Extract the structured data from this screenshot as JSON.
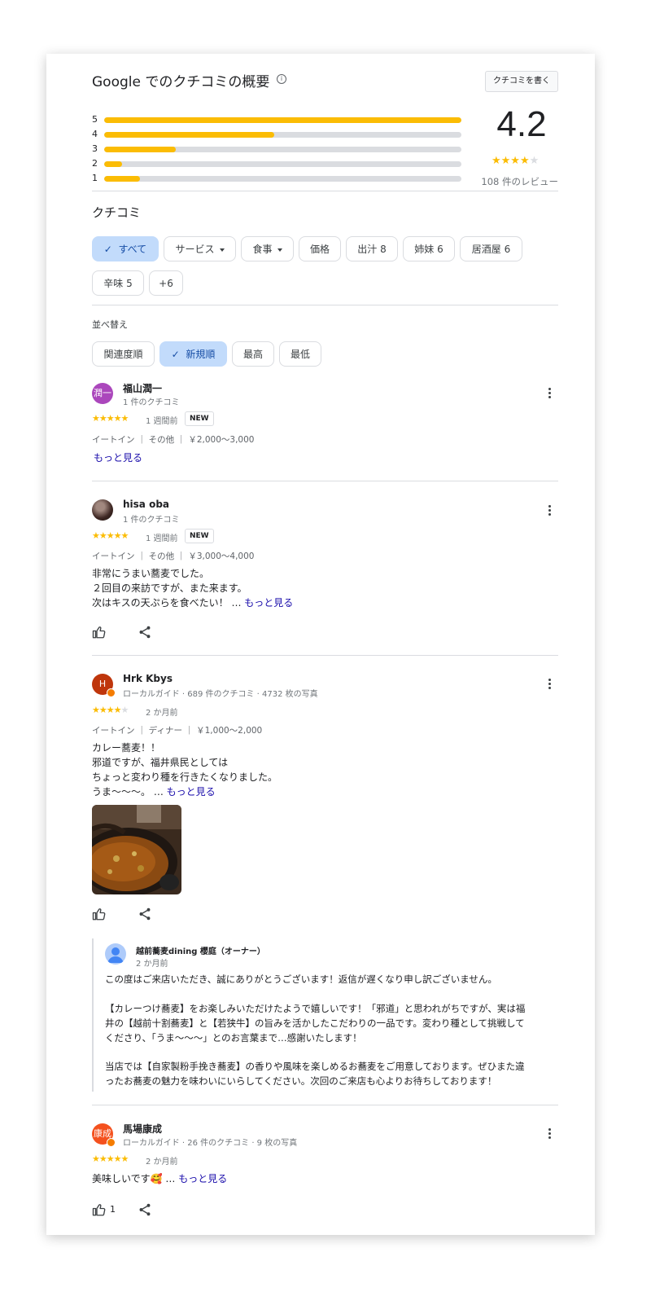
{
  "summary": {
    "title": "Google でのクチコミの概要",
    "info_glyph": "i",
    "write_label": "クチコミを書く",
    "rating": "4.2",
    "review_count": "108 件のレビュー",
    "stars_filled": 4,
    "distribution": [
      {
        "label": "5",
        "fraction": 1.0
      },
      {
        "label": "4",
        "fraction": 0.475
      },
      {
        "label": "3",
        "fraction": 0.2
      },
      {
        "label": "2",
        "fraction": 0.05
      },
      {
        "label": "1",
        "fraction": 0.1
      }
    ]
  },
  "reviews_section": {
    "heading": "クチコミ",
    "filters": [
      {
        "label": "すべて",
        "selected": true
      },
      {
        "label": "サービス",
        "dropdown": true
      },
      {
        "label": "食事",
        "dropdown": true
      },
      {
        "label": "価格"
      },
      {
        "label": "出汁 8"
      },
      {
        "label": "姉妹 6"
      },
      {
        "label": "居酒屋 6"
      },
      {
        "label": "辛味 5"
      },
      {
        "label": "+6"
      }
    ],
    "sort_label": "並べ替え",
    "sort_options": [
      {
        "label": "関連度順"
      },
      {
        "label": "新規順",
        "selected": true
      },
      {
        "label": "最高"
      },
      {
        "label": "最低"
      }
    ]
  },
  "reviews": [
    {
      "avatar_text": "潤一",
      "avatar_color": "#ab47bc",
      "name": "福山潤一",
      "sub": "1 件のクチコミ",
      "stars": 5,
      "time": "1 週間前",
      "badge": "NEW",
      "meta": "イートイン ｜ その他 ｜ ￥2,000～3,000",
      "more": "もっと見る"
    },
    {
      "avatar_color": "#4e4238",
      "name": "hisa oba",
      "sub": "1 件のクチコミ",
      "stars": 5,
      "time": "1 週間前",
      "badge": "NEW",
      "meta": "イートイン ｜ その他 ｜ ￥3,000～4,000",
      "lines": [
        "非常にうまい蕎麦でした。",
        "２回目の来訪ですが、また来ます。",
        "次はキスの天ぷらを食べたい！ …"
      ],
      "more": "もっと見る"
    },
    {
      "avatar_text": "H",
      "avatar_color": "#bf360c",
      "name": "Hrk Kbys",
      "sub": "ローカルガイド · 689 件のクチコミ · 4732 枚の写真",
      "stars": 4,
      "time": "2 か月前",
      "meta": "イートイン ｜ ディナー ｜ ￥1,000～2,000",
      "lines": [
        "カレー蕎麦！！",
        "邪道ですが、福井県民としては",
        "ちょっと変わり種を行きたくなりました。",
        "うま〜〜〜。 …"
      ],
      "more": "もっと見る",
      "owner": {
        "name": "越前蕎麦dining 櫻庭（オーナー）",
        "time": "2 か月前",
        "lines": [
          "この度はご来店いただき、誠にありがとうございます！返信が遅くなり申し訳ございません。",
          "",
          "【カレーつけ蕎麦】をお楽しみいただけたようで嬉しいです！「邪道」と思われがちですが、実は福",
          "井の【越前十割蕎麦】と【若狭牛】の旨みを活かしたこだわりの一品です。変わり種として挑戦して",
          "くださり、「うま〜〜〜」とのお言葉まで…感謝いたします！",
          "",
          "当店では【自家製粉手挽き蕎麦】の香りや風味を楽しめるお蕎麦をご用意しております。ぜひまた違",
          "ったお蕎麦の魅力を味わいにいらしてください。次回のご来店も心よりお待ちしております！"
        ]
      }
    },
    {
      "avatar_text": "康成",
      "avatar_color": "#f4511e",
      "name": "馬場康成",
      "sub": "ローカルガイド · 26 件のクチコミ · 9 枚の写真",
      "stars": 5,
      "time": "2 か月前",
      "lines": [
        "美味しいです🥰 …"
      ],
      "more": "もっと見る",
      "likes": "1"
    }
  ]
}
